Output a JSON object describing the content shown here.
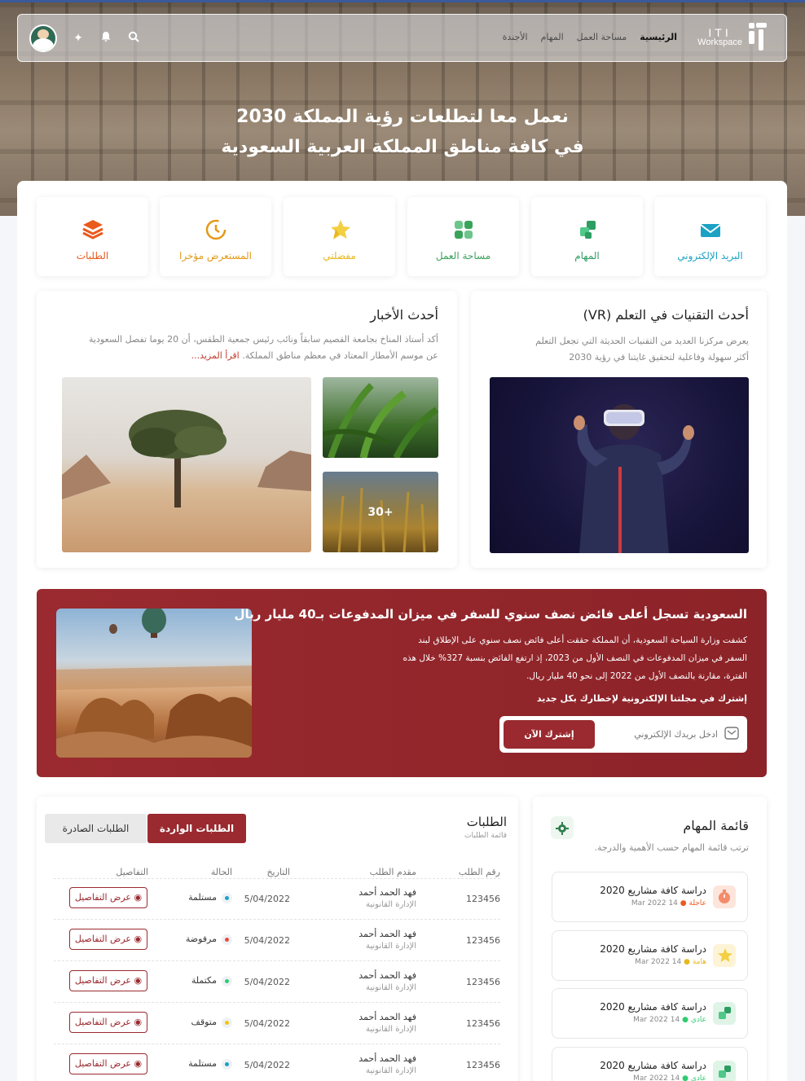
{
  "brand": {
    "line1": "ITI",
    "line2": "Workspace"
  },
  "nav": {
    "links": [
      "الرئيسية",
      "مساحة العمل",
      "المهام",
      "الأجندة"
    ]
  },
  "hero": {
    "line1": "نعمل معا لتطلعات رؤية المملكة 2030",
    "line2": "في كافة مناطق المملكة العربية السعودية"
  },
  "tiles": [
    {
      "label": "البريد الإلكتروني",
      "color": "#1ba2c4",
      "icon": "mail-icon"
    },
    {
      "label": "المهام",
      "color": "#2e9d62",
      "icon": "tasks-icon"
    },
    {
      "label": "مساحة العمل",
      "color": "#3aa35a",
      "icon": "workspace-icon"
    },
    {
      "label": "مفضلتي",
      "color": "#e6b81f",
      "icon": "favorites-icon"
    },
    {
      "label": "المستعرض مؤخرا",
      "color": "#e39a1a",
      "icon": "history-icon"
    },
    {
      "label": "الطلبات",
      "color": "#ea5a1d",
      "icon": "layers-icon"
    }
  ],
  "vr": {
    "title": "أحدث التقنيات في التعلم (VR)",
    "desc1": "يعرض مركزنا العديد من التقنيات الحديثة التي تجعل التعلم",
    "desc2": "أكثر سهولة وفاعلية لتحقيق غايتنا في رؤية 2030"
  },
  "news": {
    "title": "أحدث الأخبار",
    "desc1": "أكد أستاذ المناخ بجامعة القصيم سابقاً ونائب رئيس جمعية الطقس، أن 20 يوما تفصل السعودية",
    "desc2": "عن موسم الأمطار المعتاد في معظم مناطق المملكة.",
    "more": "اقرأ المزيد...",
    "extra_count": "+30"
  },
  "promo": {
    "title": "السعودية تسجل أعلى فائض نصف سنوي للسفر في ميزان المدفوعات بـ40 مليار ريال",
    "p1": "كشفت وزارة السياحة السعودية، أن المملكة حققت أعلى فائض نصف سنوي على الإطلاق لبند",
    "p2": "السفر في ميزان المدفوعات في النصف الأول من 2023، إذ ارتفع الفائض بنسبة 327% خلال هذه",
    "p3": "الفترة، مقارنة بالنصف الأول من 2022 إلى نحو 40 مليار ريال.",
    "subscribe_note": "إشترك في مجلتنا الإلكترونية لإخطارك بكل جديد",
    "email_placeholder": "ادخل بريدك الإلكتروني",
    "subscribe_btn": "إشترك الآن"
  },
  "requests": {
    "title": "الطلبات",
    "subtitle": "قائمة الطلبات",
    "tab_incoming": "الطلبات الواردة",
    "tab_outgoing": "الطلبات الصادرة",
    "headers": [
      "رقم الطلب",
      "مقدم الطلب",
      "التاريخ",
      "الحالة",
      "التفاصيل"
    ],
    "rows": [
      {
        "id": "123456",
        "name": "فهد الحمد أحمد",
        "dept": "الإدارة القانونية",
        "date": "5/04/2022",
        "status": "مستلمة",
        "color": "#1ba2c4",
        "action": "عرض التفاصيل"
      },
      {
        "id": "123456",
        "name": "فهد الحمد أحمد",
        "dept": "الإدارة القانونية",
        "date": "5/04/2022",
        "status": "مرفوضة",
        "color": "#e74c3c",
        "action": "عرض التفاصيل"
      },
      {
        "id": "123456",
        "name": "فهد الحمد أحمد",
        "dept": "الإدارة القانونية",
        "date": "5/04/2022",
        "status": "مكتملة",
        "color": "#2ecc71",
        "action": "عرض التفاصيل"
      },
      {
        "id": "123456",
        "name": "فهد الحمد أحمد",
        "dept": "الإدارة القانونية",
        "date": "5/04/2022",
        "status": "متوقف",
        "color": "#f1c40f",
        "action": "عرض التفاصيل"
      },
      {
        "id": "123456",
        "name": "فهد الحمد أحمد",
        "dept": "الإدارة القانونية",
        "date": "5/04/2022",
        "status": "مستلمة",
        "color": "#1ba2c4",
        "action": "عرض التفاصيل"
      }
    ]
  },
  "tasks": {
    "title": "قائمة المهام",
    "subtitle": "ترتب قائمة المهام حسب الأهمية والدرجة.",
    "items": [
      {
        "title": "دراسة كافة مشاريع 2020",
        "priority": "عاجلة",
        "date": "14 Mar 2022",
        "color": "#ea5a1d",
        "icon": "timer-icon",
        "bg": "#fde5dc"
      },
      {
        "title": "دراسة كافة مشاريع 2020",
        "priority": "هامة",
        "date": "14 Mar 2022",
        "color": "#e6b81f",
        "icon": "star-icon",
        "bg": "#fdf3d6"
      },
      {
        "title": "دراسة كافة مشاريع 2020",
        "priority": "عادي",
        "date": "14 Mar 2022",
        "color": "#2ecc71",
        "icon": "tasks-icon",
        "bg": "#dff4e7"
      },
      {
        "title": "دراسة كافة مشاريع 2020",
        "priority": "عادي",
        "date": "14 Mar 2022",
        "color": "#2ecc71",
        "icon": "tasks-icon",
        "bg": "#dff4e7"
      }
    ]
  }
}
